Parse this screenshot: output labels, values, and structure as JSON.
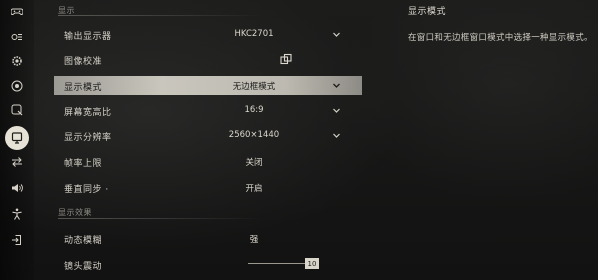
{
  "sidebar": {
    "icons": [
      {
        "name": "gamepad-icon"
      },
      {
        "name": "controller-settings-icon"
      },
      {
        "name": "gear-icon"
      },
      {
        "name": "eye-icon"
      },
      {
        "name": "magnifier-icon"
      },
      {
        "name": "display-icon",
        "active": true
      },
      {
        "name": "swap-arrows-icon"
      },
      {
        "name": "speaker-icon"
      },
      {
        "name": "accessibility-icon"
      },
      {
        "name": "exit-icon"
      }
    ]
  },
  "sections": {
    "display": "显示",
    "effects": "显示效果"
  },
  "rows": [
    {
      "label": "输出显示器",
      "value": "HKC2701",
      "dropdown": true
    },
    {
      "label": "图像校准",
      "value": "",
      "icon": "copy-icon"
    },
    {
      "label": "显示模式",
      "value": "无边框模式",
      "dropdown": true,
      "selected": true
    },
    {
      "label": "屏幕宽高比",
      "value": "16:9",
      "dropdown": true
    },
    {
      "label": "显示分辨率",
      "value": "2560×1440",
      "dropdown": true
    },
    {
      "label": "帧率上限",
      "value": "关闭"
    },
    {
      "label": "垂直同步 ·",
      "value": "开启"
    },
    {
      "label": "动态模糊",
      "value": "强"
    },
    {
      "label": "镜头震动",
      "slider_value": "10",
      "slider_level": 1.0
    }
  ],
  "panel": {
    "title": "显示模式",
    "description": "在窗口和无边框窗口模式中选择一种显示模式。"
  },
  "colors": {
    "selected_row": "#c9c6bd",
    "active_icon_bg": "#e6e2d6"
  }
}
